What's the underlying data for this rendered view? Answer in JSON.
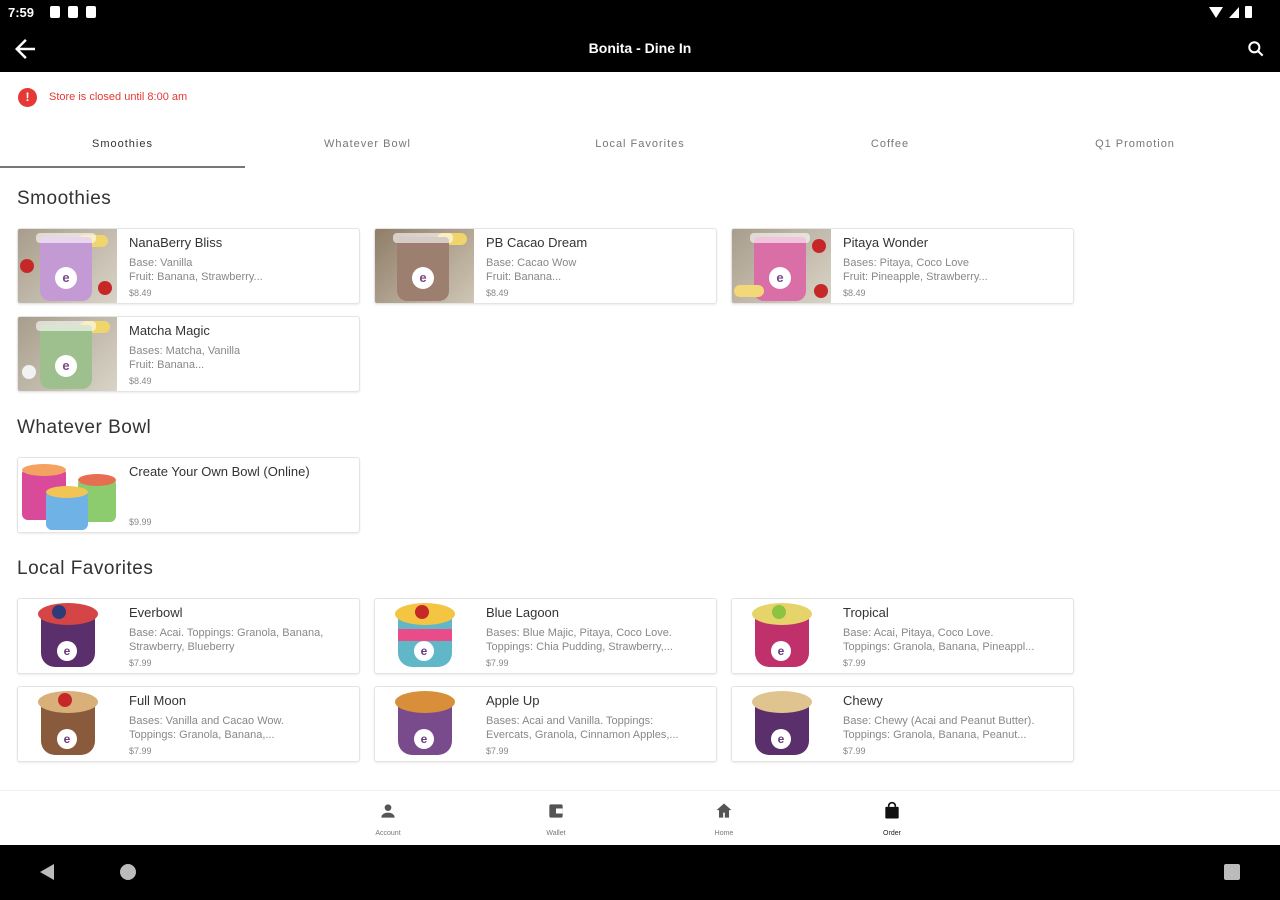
{
  "status_bar": {
    "time": "7:59"
  },
  "app_bar": {
    "title": "Bonita - Dine In"
  },
  "alert": {
    "icon": "!",
    "text": "Store is closed until 8:00 am"
  },
  "tabs": [
    {
      "label": "Smoothies",
      "active": true
    },
    {
      "label": "Whatever Bowl",
      "active": false
    },
    {
      "label": "Local Favorites",
      "active": false
    },
    {
      "label": "Coffee",
      "active": false
    },
    {
      "label": "Q1 Promotion",
      "active": false
    }
  ],
  "sections": {
    "smoothies": {
      "title": "Smoothies",
      "items": [
        {
          "name": "NanaBerry Bliss",
          "line1": "Base: Vanilla",
          "line2": "Fruit: Banana, Strawberry...",
          "price": "$8.49"
        },
        {
          "name": "PB Cacao Dream",
          "line1": "Base: Cacao Wow",
          "line2": "Fruit: Banana...",
          "price": "$8.49"
        },
        {
          "name": "Pitaya Wonder",
          "line1": "Bases: Pitaya, Coco Love",
          "line2": "Fruit: Pineapple, Strawberry...",
          "price": "$8.49"
        },
        {
          "name": "Matcha Magic",
          "line1": "Bases: Matcha, Vanilla",
          "line2": "Fruit: Banana...",
          "price": "$8.49"
        }
      ]
    },
    "whatever_bowl": {
      "title": "Whatever Bowl",
      "items": [
        {
          "name": "Create Your Own Bowl (Online)",
          "price": "$9.99"
        }
      ]
    },
    "local_favorites": {
      "title": "Local Favorites",
      "items": [
        {
          "name": "Everbowl",
          "line1": "Base: Acai. Toppings: Granola, Banana,",
          "line2": "Strawberry, Blueberry",
          "price": "$7.99"
        },
        {
          "name": "Blue Lagoon",
          "line1": "Bases: Blue Majic, Pitaya, Coco Love.",
          "line2": "Toppings: Chia Pudding, Strawberry,...",
          "price": "$7.99"
        },
        {
          "name": "Tropical",
          "line1": "Base: Acai, Pitaya, Coco Love.",
          "line2": "Toppings: Granola, Banana, Pineappl...",
          "price": "$7.99"
        },
        {
          "name": "Full Moon",
          "line1": "Bases: Vanilla and Cacao Wow.",
          "line2": "Toppings: Granola, Banana,...",
          "price": "$7.99"
        },
        {
          "name": "Apple Up",
          "line1": "Bases: Acai and Vanilla. Toppings:",
          "line2": "Evercats, Granola, Cinnamon Apples,...",
          "price": "$7.99"
        },
        {
          "name": "Chewy",
          "line1": "Base: Chewy (Acai and Peanut Butter).",
          "line2": "Toppings: Granola, Banana, Peanut...",
          "price": "$7.99"
        }
      ]
    }
  },
  "bottom_nav": [
    {
      "label": "Account",
      "icon": "person-icon"
    },
    {
      "label": "Wallet",
      "icon": "wallet-icon"
    },
    {
      "label": "Home",
      "icon": "home-icon"
    },
    {
      "label": "Order",
      "icon": "bag-icon"
    }
  ],
  "colors": {
    "alert": "#e53935",
    "bar": "#000000"
  }
}
